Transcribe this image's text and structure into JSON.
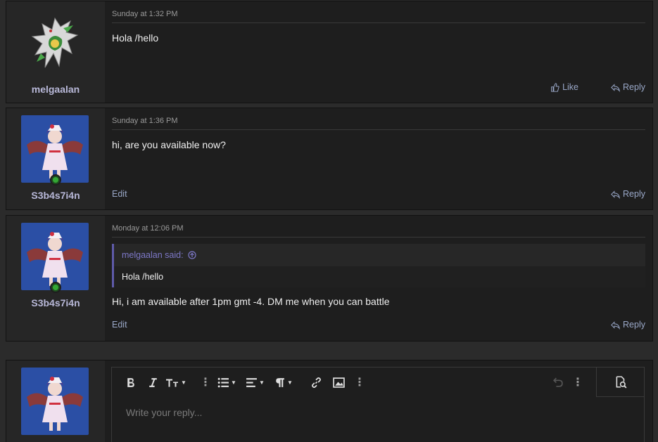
{
  "posts": [
    {
      "username": "melgaalan",
      "timestamp": "Sunday at 1:32 PM",
      "message": "Hola /hello",
      "actions": {
        "like": "Like",
        "reply": "Reply"
      }
    },
    {
      "username": "S3b4s7i4n",
      "timestamp": "Sunday at 1:36 PM",
      "message": "hi, are you available now?",
      "actions": {
        "edit": "Edit",
        "reply": "Reply"
      }
    },
    {
      "username": "S3b4s7i4n",
      "timestamp": "Monday at 12:06 PM",
      "quote": {
        "author": "melgaalan said:",
        "text": "Hola /hello"
      },
      "message": "Hi, i am available after 1pm gmt -4. DM me when you can battle",
      "actions": {
        "edit": "Edit",
        "reply": "Reply"
      }
    }
  ],
  "editor": {
    "placeholder": "Write your reply..."
  },
  "colors": {
    "background": "#2b2b2b",
    "post_bg": "#1e1e1e",
    "user_column_bg": "#262626",
    "username": "#b8b8d8",
    "action_link": "#9aa8c8",
    "quote_accent": "#5e5aa8",
    "online": "#34a834"
  }
}
